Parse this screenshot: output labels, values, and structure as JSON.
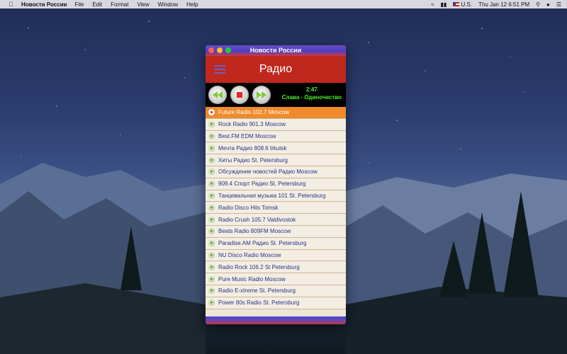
{
  "menubar": {
    "app_name": "Новости России",
    "items": [
      "File",
      "Edit",
      "Format",
      "View",
      "Window",
      "Help"
    ],
    "keyboard": "U.S.",
    "clock": "Thu Jan 12  6:51 PM"
  },
  "window": {
    "title": "Новости России",
    "header_title": "Радио",
    "player": {
      "time": "2:47",
      "track": "Слава - Одиночество"
    },
    "stations": [
      "Future Radio 102.7 Moscow",
      "Rock Radio 901.3 Moscow",
      "Best.FM EDM Moscow",
      "Мечта Радио 808.6 Irkutsk",
      "Хиты Радио St. Petersburg",
      "Обсуждение новостей Радио Moscow",
      "909.4 Спорт Радио St. Petersburg",
      "Танцевальная музыка 101 St. Petersburg",
      "Radio Disco Hits Tomsk",
      "Radio Crush 105.7 Valdivostok",
      "Beats Radio 809FM Moscow",
      "Paradise.AM Радио St. Petersburg",
      "NU Disco Radio Moscow",
      "Radio Rock 106.2 St Petersburg",
      "Pure Music Radio Moscow",
      "Radio E-xtreme St. Petersburg",
      "Power 80s Radio St. Petersburg"
    ],
    "active_station_index": 0
  }
}
